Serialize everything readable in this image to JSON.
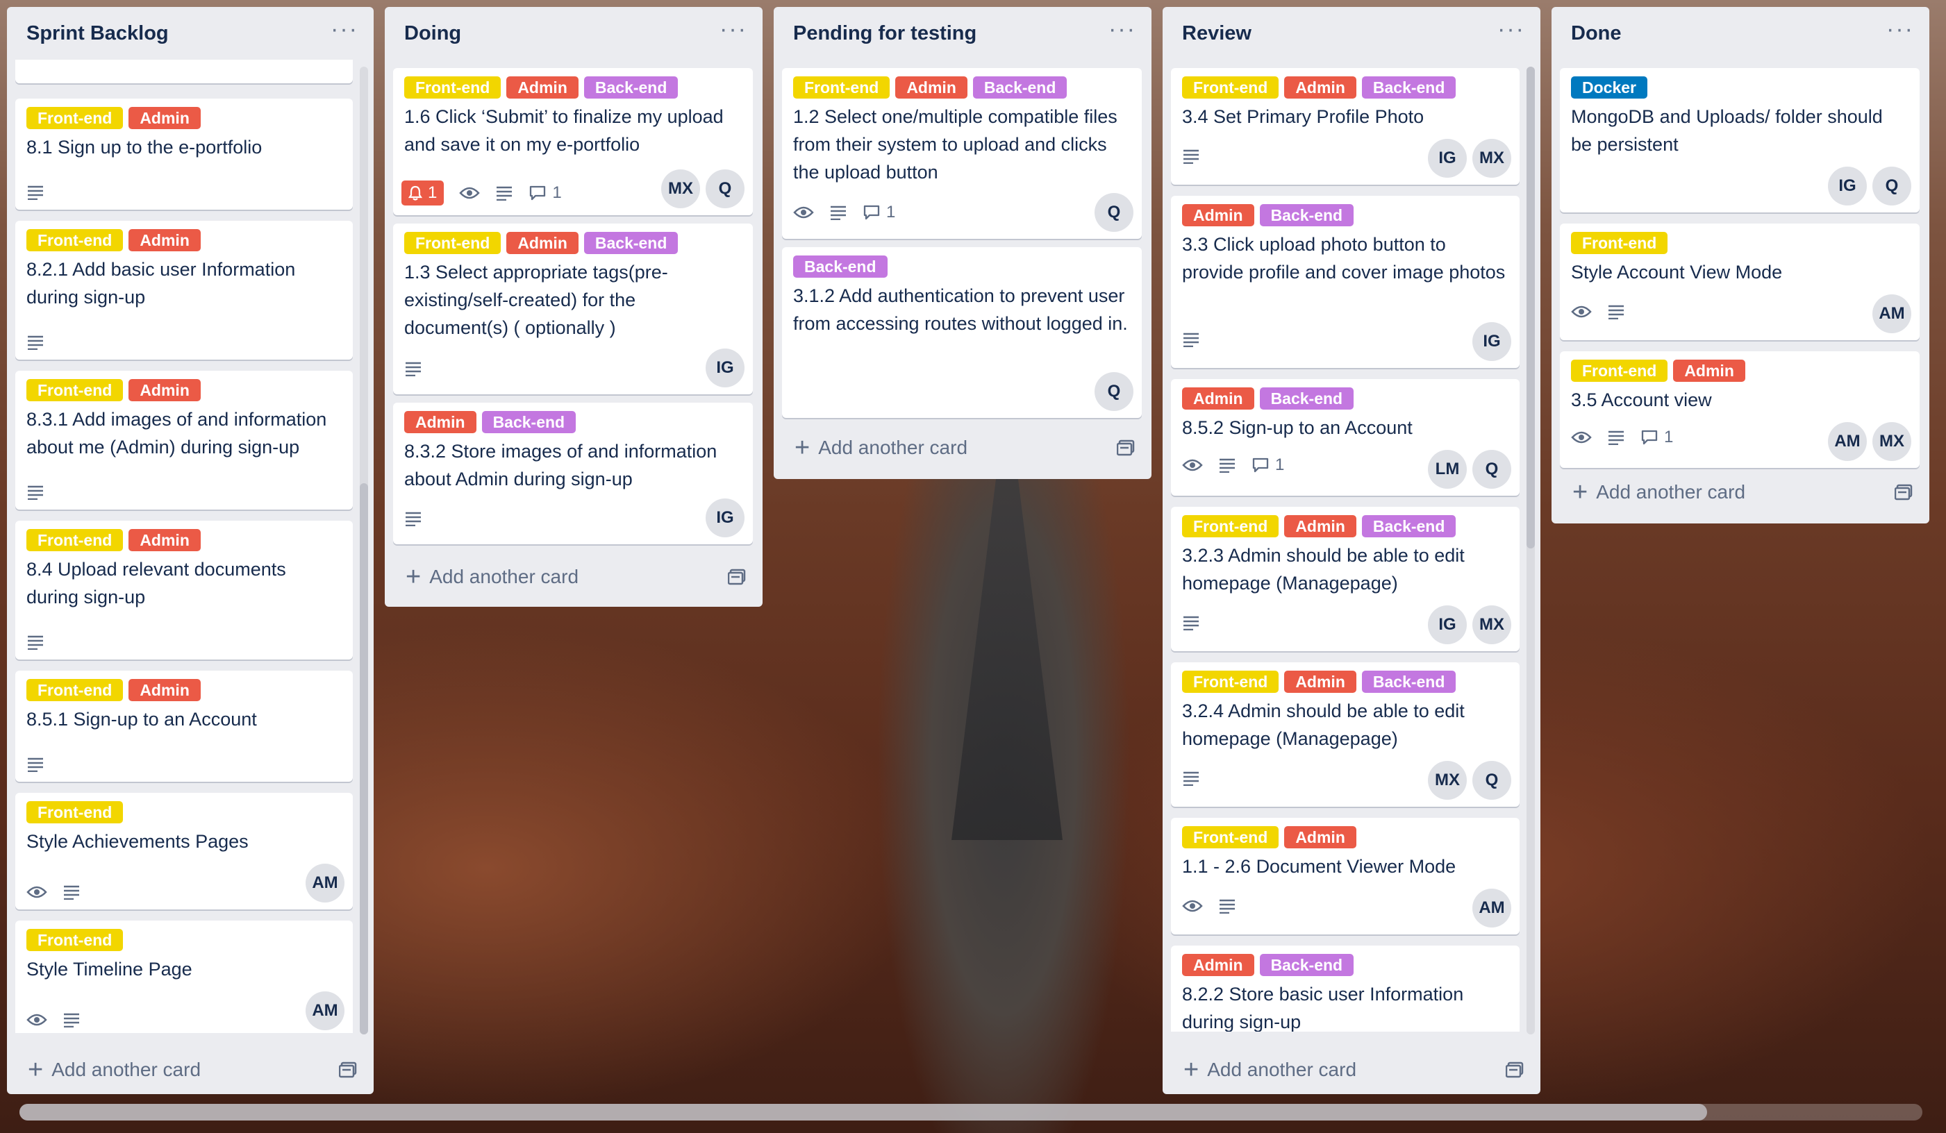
{
  "lists": [
    {
      "title": "Sprint Backlog",
      "menu": "···",
      "add_card": "Add another card",
      "cards": [
        {
          "labels": [
            "Front-end",
            "Admin"
          ],
          "title": "8.1 Sign up to the e-portfolio",
          "members": []
        },
        {
          "labels": [
            "Front-end",
            "Admin"
          ],
          "title": "8.2.1 Add basic user Information during sign-up",
          "members": []
        },
        {
          "labels": [
            "Front-end",
            "Admin"
          ],
          "title": "8.3.1 Add images of and information about me (Admin) during sign-up",
          "members": []
        },
        {
          "labels": [
            "Front-end",
            "Admin"
          ],
          "title": "8.4 Upload relevant documents during sign-up",
          "members": []
        },
        {
          "labels": [
            "Front-end",
            "Admin"
          ],
          "title": "8.5.1 Sign-up to an Account",
          "members": []
        },
        {
          "labels": [
            "Front-end"
          ],
          "title": "Style Achievements Pages",
          "members": [
            "AM"
          ]
        },
        {
          "labels": [
            "Front-end"
          ],
          "title": "Style Timeline Page",
          "members": [
            "AM"
          ]
        }
      ]
    },
    {
      "title": "Doing",
      "menu": "···",
      "add_card": "Add another card",
      "cards": [
        {
          "labels": [
            "Front-end",
            "Admin",
            "Back-end"
          ],
          "title": "1.6 Click ‘Submit’ to finalize my upload and save it on my e-portfolio",
          "notifications": "1",
          "comments": "1",
          "members": [
            "MX",
            "Q"
          ]
        },
        {
          "labels": [
            "Front-end",
            "Admin",
            "Back-end"
          ],
          "title": "1.3 Select appropriate tags(pre-existing/self-created) for the document(s) ( optionally )",
          "members": [
            "IG"
          ]
        },
        {
          "labels": [
            "Admin",
            "Back-end"
          ],
          "title": "8.3.2 Store images of and information about Admin during sign-up",
          "members": [
            "IG"
          ]
        }
      ]
    },
    {
      "title": "Pending for testing",
      "menu": "···",
      "add_card": "Add another card",
      "cards": [
        {
          "labels": [
            "Front-end",
            "Admin",
            "Back-end"
          ],
          "title": "1.2 Select one/multiple compatible files from their system to upload and clicks the upload button",
          "comments": "1",
          "members": [
            "Q"
          ]
        },
        {
          "labels": [
            "Back-end"
          ],
          "title": "3.1.2 Add authentication to prevent user from accessing routes without logged in.",
          "members": [
            "Q"
          ]
        }
      ]
    },
    {
      "title": "Review",
      "menu": "···",
      "add_card": "Add another card",
      "cards": [
        {
          "labels": [
            "Front-end",
            "Admin",
            "Back-end"
          ],
          "title": "3.4 Set Primary Profile Photo",
          "members": [
            "IG",
            "MX"
          ]
        },
        {
          "labels": [
            "Admin",
            "Back-end"
          ],
          "title": "3.3 Click upload photo button to provide profile and cover image photos",
          "members": [
            "IG"
          ]
        },
        {
          "labels": [
            "Admin",
            "Back-end"
          ],
          "title": "8.5.2 Sign-up to an Account",
          "comments": "1",
          "members": [
            "LM",
            "Q"
          ]
        },
        {
          "labels": [
            "Front-end",
            "Admin",
            "Back-end"
          ],
          "title": "3.2.3 Admin should be able to edit homepage (Managepage)",
          "members": [
            "IG",
            "MX"
          ]
        },
        {
          "labels": [
            "Front-end",
            "Admin",
            "Back-end"
          ],
          "title": "3.2.4 Admin should be able to edit homepage (Managepage)",
          "members": [
            "MX",
            "Q"
          ]
        },
        {
          "labels": [
            "Front-end",
            "Admin"
          ],
          "title": "1.1 - 2.6 Document Viewer Mode",
          "members": [
            "AM"
          ]
        },
        {
          "labels": [
            "Admin",
            "Back-end"
          ],
          "title": "8.2.2 Store basic user Information during sign-up",
          "members": []
        }
      ]
    },
    {
      "title": "Done",
      "menu": "···",
      "add_card": "Add another card",
      "cards": [
        {
          "labels": [
            "Docker"
          ],
          "title": "MongoDB and Uploads/ folder should be persistent",
          "members": [
            "IG",
            "Q"
          ]
        },
        {
          "labels": [
            "Front-end"
          ],
          "title": "Style Account View Mode",
          "members": [
            "AM"
          ]
        },
        {
          "labels": [
            "Front-end",
            "Admin"
          ],
          "title": "3.5 Account view",
          "comments": "1",
          "members": [
            "AM",
            "MX"
          ]
        }
      ]
    }
  ],
  "colors": {
    "front_end": "#f2d600",
    "admin": "#eb5a46",
    "back_end": "#c377e0",
    "docker": "#0079bf",
    "list_bg": "#ebecf0"
  },
  "icons": [
    "watch-icon",
    "description-icon",
    "comment-icon",
    "notification-bell-icon",
    "plus-icon",
    "card-template-icon",
    "list-menu-icon"
  ]
}
